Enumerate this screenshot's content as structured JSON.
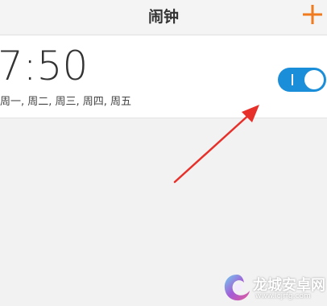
{
  "header": {
    "title": "闹钟",
    "add_icon": "plus-icon",
    "accent_color": "#f07a1e"
  },
  "alarm": {
    "time": "7:50",
    "repeat_days": "周一, 周二, 周三, 周四, 周五",
    "enabled": true,
    "toggle_color": "#1b8ed9"
  },
  "annotation": {
    "icon": "red-arrow-icon",
    "color": "#e8302a"
  },
  "watermark": {
    "title": "龙城安卓网",
    "url": "www.lcjrfg.com",
    "icon": "dragon-logo-icon"
  }
}
